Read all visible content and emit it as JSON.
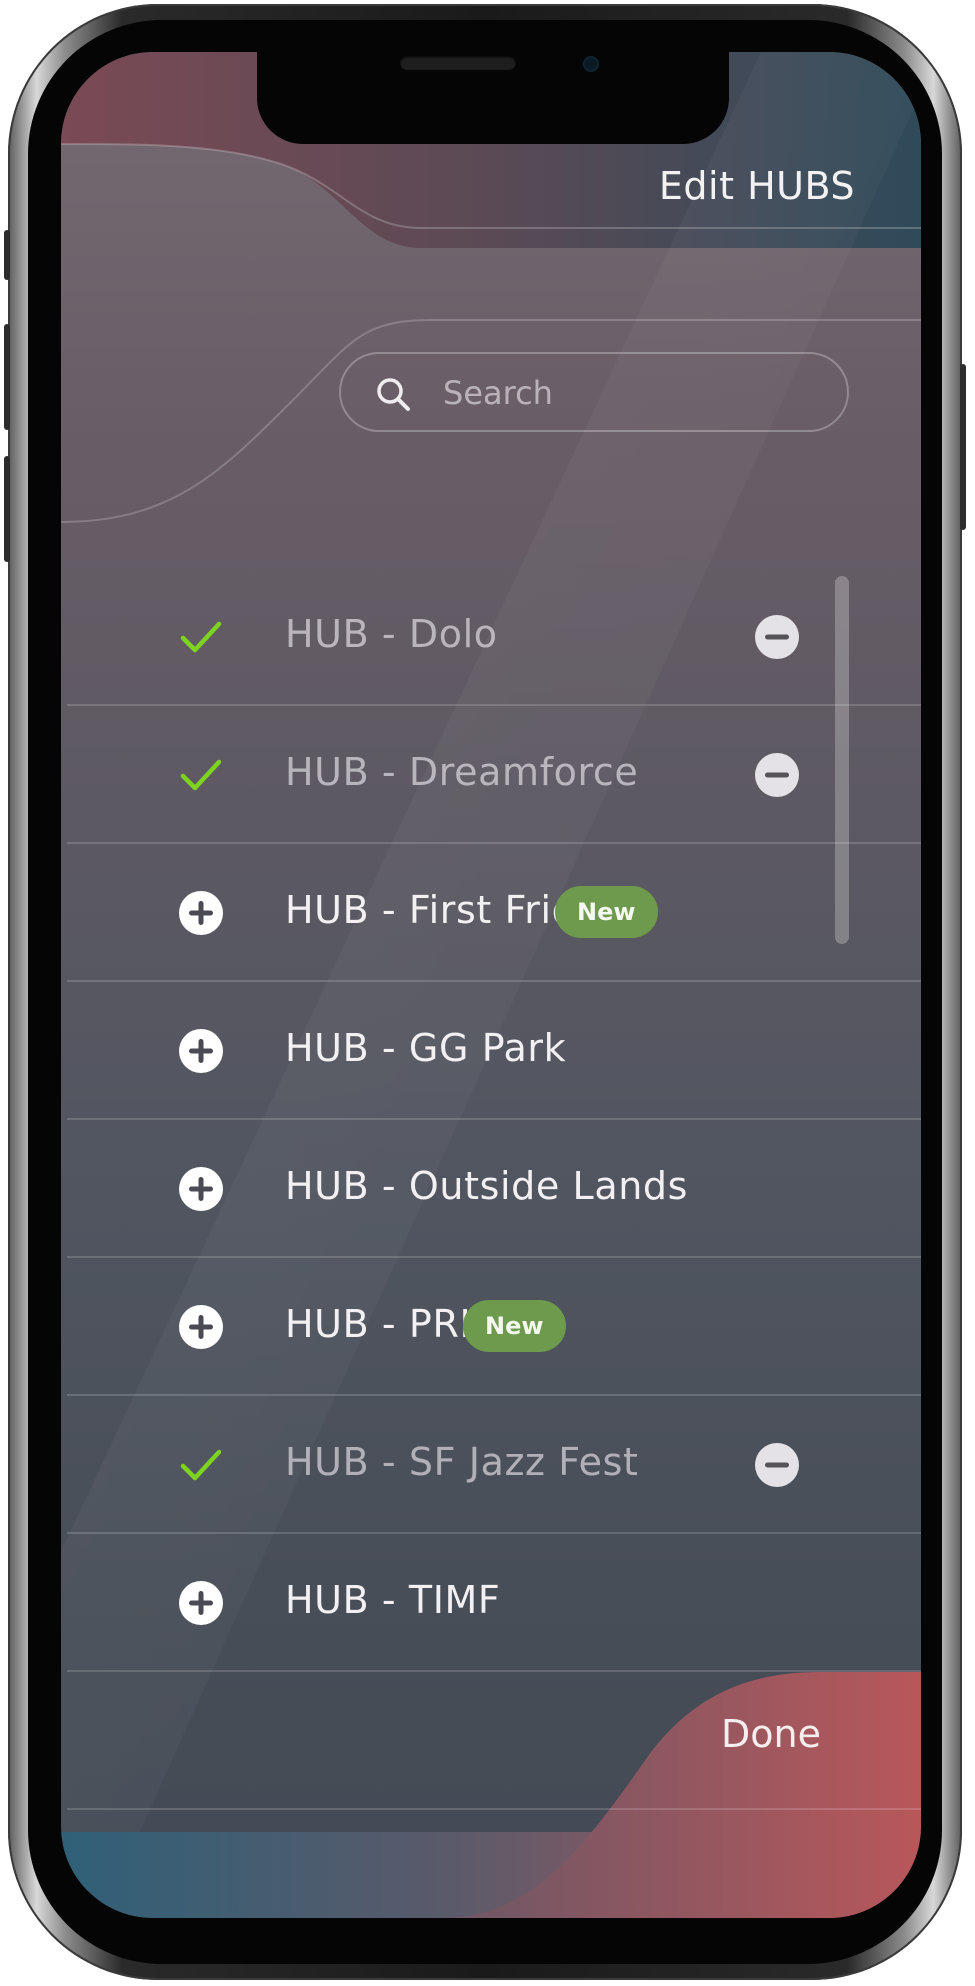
{
  "header": {
    "title": "Edit HUBS"
  },
  "search": {
    "placeholder": "Search"
  },
  "hubs": [
    {
      "name": "HUB - Dolo",
      "subscribed": true,
      "new": false
    },
    {
      "name": "HUB - Dreamforce",
      "subscribed": true,
      "new": false
    },
    {
      "name": "HUB - First Fridays",
      "subscribed": false,
      "new": true
    },
    {
      "name": "HUB - GG Park",
      "subscribed": false,
      "new": false
    },
    {
      "name": "HUB - Outside Lands",
      "subscribed": false,
      "new": false
    },
    {
      "name": "HUB - PRIDE",
      "subscribed": false,
      "new": true
    },
    {
      "name": "HUB - SF Jazz Fest",
      "subscribed": true,
      "new": false
    },
    {
      "name": "HUB - TIMF",
      "subscribed": false,
      "new": false
    }
  ],
  "badge_label": "New",
  "footer": {
    "done_label": "Done"
  },
  "colors": {
    "check": "#7ed321",
    "badge": "#6d9a4c",
    "accent_red": "#b8575a",
    "accent_teal": "#2f6078"
  },
  "icons": {
    "subscribed": "check-icon",
    "unsubscribed": "plus-circle-icon",
    "remove": "minus-circle-icon",
    "search": "search-icon"
  }
}
